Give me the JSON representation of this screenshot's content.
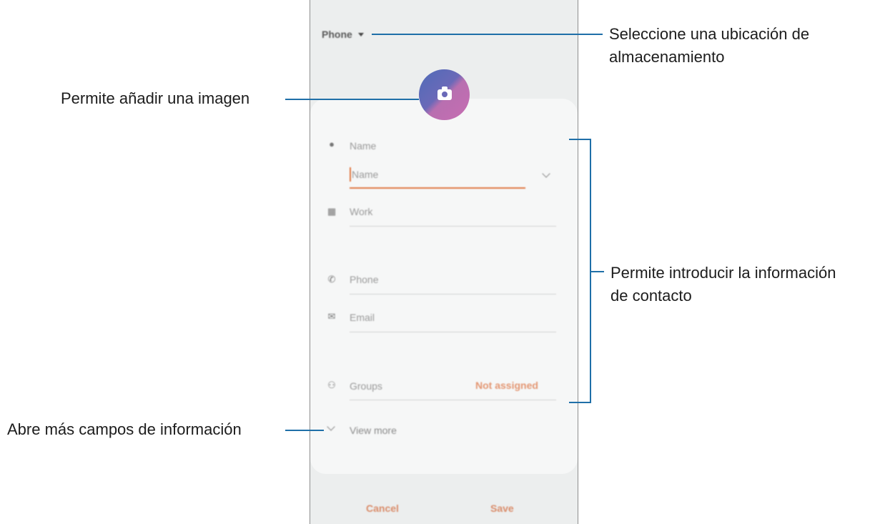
{
  "phone": {
    "storage_label": "Phone",
    "fields": {
      "name_header": "Name",
      "name_input_placeholder": "Name",
      "work": "Work",
      "phone": "Phone",
      "email": "Email",
      "groups": "Groups",
      "groups_value": "Not assigned",
      "view_more": "View more"
    },
    "buttons": {
      "cancel": "Cancel",
      "save": "Save"
    },
    "icons": {
      "storage_dropdown": "caret-down-icon",
      "avatar": "camera-icon",
      "name": "person-icon",
      "work": "building-icon",
      "phone": "phone-icon",
      "email": "envelope-icon",
      "groups": "people-icon",
      "name_expand": "chevron-down-icon",
      "view_more": "chevron-down-icon"
    },
    "colors": {
      "accent": "#e07a45",
      "avatar_gradient_start": "#4f6cb8",
      "avatar_gradient_end": "#c76db2",
      "callout_line": "#1f6fa8"
    }
  },
  "callouts": {
    "storage_line1": "Seleccione una ubicación de",
    "storage_line2": "almacenamiento",
    "image": "Permite añadir una imagen",
    "contact_line1": "Permite introducir la información",
    "contact_line2": "de contacto",
    "more_fields": "Abre más campos de información"
  }
}
